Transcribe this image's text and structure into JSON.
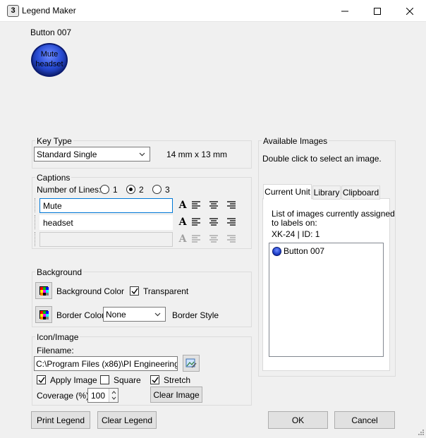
{
  "window": {
    "title": "Legend Maker"
  },
  "preview": {
    "label": "Button 007",
    "line1": "Mute",
    "line2": "headset"
  },
  "key_type": {
    "group_label": "Key Type",
    "selected": "Standard Single",
    "dimensions": "14 mm x 13 mm"
  },
  "captions": {
    "group_label": "Captions",
    "lines_label": "Number of Lines:",
    "options": [
      "1",
      "2",
      "3"
    ],
    "selected_lines": "2",
    "line1": "Mute",
    "line2": "headset",
    "line3": ""
  },
  "background": {
    "group_label": "Background",
    "bg_color_label": "Background Color",
    "transparent_label": "Transparent",
    "transparent_checked": true,
    "border_color_label": "Border Color",
    "border_style_value": "None",
    "border_style_label": "Border Style"
  },
  "icon_image": {
    "group_label": "Icon/Image",
    "filename_label": "Filename:",
    "filename_value": "C:\\Program Files (x86)\\PI Engineering\\Ma",
    "apply_label": "Apply Image",
    "apply_checked": true,
    "square_label": "Square",
    "square_checked": false,
    "stretch_label": "Stretch",
    "stretch_checked": true,
    "coverage_label": "Coverage (%)",
    "coverage_value": "100",
    "clear_image_label": "Clear Image"
  },
  "available_images": {
    "group_label": "Available Images",
    "hint": "Double click to select an image.",
    "tabs": [
      "Current Unit",
      "Library",
      "Clipboard"
    ],
    "active_tab": "Current Unit",
    "desc_line1": "List of images currently assigned",
    "desc_line2": "to labels on:",
    "unit_info": "XK-24 | ID: 1",
    "items": [
      {
        "label": "Button 007"
      }
    ]
  },
  "footer": {
    "print_label": "Print Legend",
    "clear_legend_label": "Clear Legend",
    "ok_label": "OK",
    "cancel_label": "Cancel"
  },
  "colors": {
    "accent": "#0078d7",
    "swatch": [
      "#ff0000",
      "#00c000",
      "#0000ff",
      "#ffff00",
      "#ff00ff",
      "#00ffff",
      "#ff8000",
      "#000000",
      "#808080"
    ]
  }
}
